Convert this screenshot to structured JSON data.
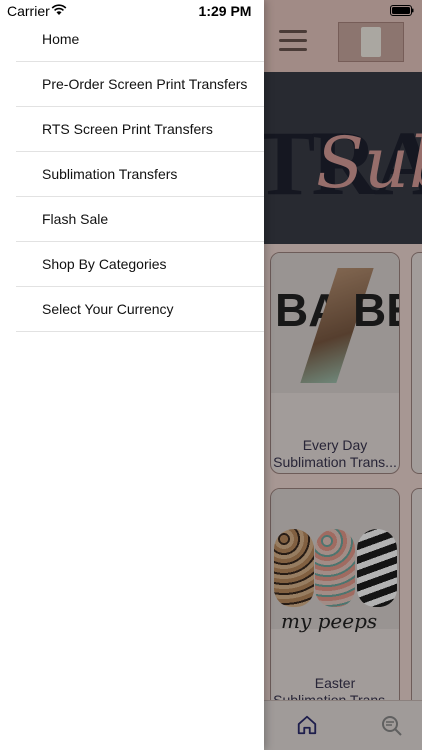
{
  "status_bar": {
    "carrier": "Carrier",
    "time": "1:29 PM"
  },
  "drawer": {
    "items": [
      {
        "label": "Home"
      },
      {
        "label": "Pre-Order Screen Print Transfers"
      },
      {
        "label": "RTS Screen Print Transfers"
      },
      {
        "label": "Sublimation Transfers"
      },
      {
        "label": "Flash Sale"
      },
      {
        "label": "Shop By Categories"
      },
      {
        "label": "Select Your Currency"
      }
    ]
  },
  "background": {
    "banner_text": "TRA",
    "banner_script": "Sub",
    "products": [
      {
        "caption_line1": "Every Day",
        "caption_line2": "Sublimation Trans...",
        "art_left": "BA",
        "art_right": "BE"
      },
      {
        "caption_line1": "Easter",
        "caption_line2": "Sublimation Trans...",
        "art_text": "my peeps"
      }
    ]
  },
  "colors": {
    "accent": "#2c2c6e",
    "overlay": "rgba(0,0,0,0.30)"
  },
  "icons": {
    "menu": "hamburger-icon",
    "home": "home-icon",
    "search": "search-icon",
    "wifi": "wifi-icon",
    "battery": "battery-icon"
  }
}
